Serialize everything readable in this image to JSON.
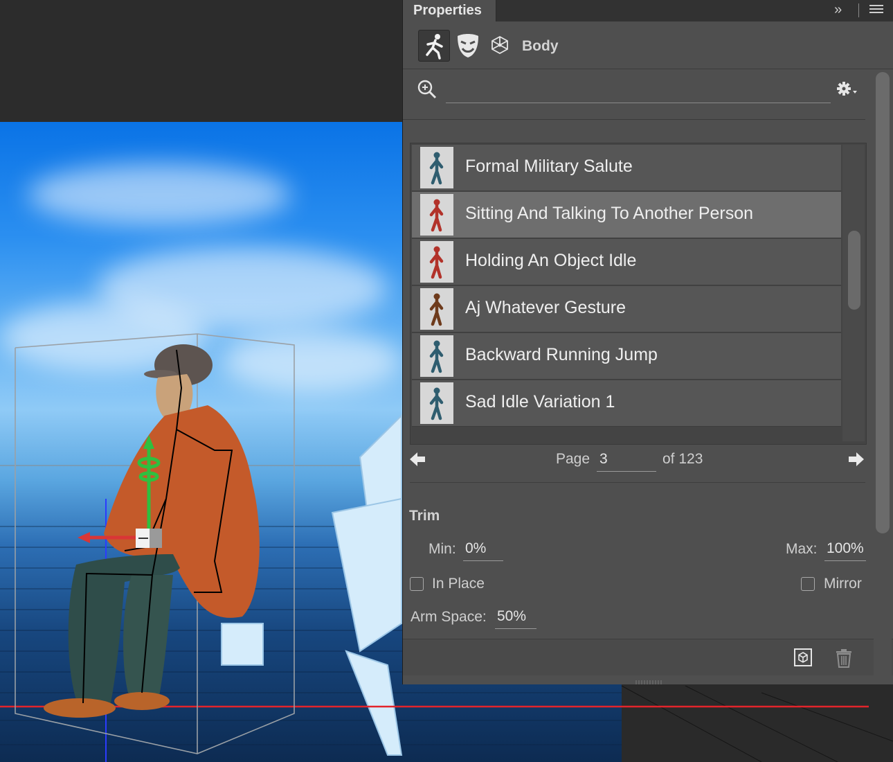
{
  "panel": {
    "title": "Properties",
    "collapse_icon": "double-chevron-right-icon",
    "menu_icon": "hamburger-menu-icon",
    "mode_label": "Body",
    "tools": [
      "body-pose-icon",
      "face-mask-icon",
      "mesh-cube-icon"
    ]
  },
  "search": {
    "value": "",
    "placeholder": "",
    "settings_icon": "gear-dropdown-icon"
  },
  "animations": {
    "items": [
      {
        "label": "Formal Military Salute",
        "thumb_color": "#2f5d6f",
        "selected": false
      },
      {
        "label": "Sitting And Talking To Another Person",
        "thumb_color": "#b2322a",
        "selected": true
      },
      {
        "label": "Holding An Object Idle",
        "thumb_color": "#b2322a",
        "selected": false
      },
      {
        "label": "Aj Whatever Gesture",
        "thumb_color": "#6e3b1c",
        "selected": false
      },
      {
        "label": "Backward Running Jump",
        "thumb_color": "#2f5d6f",
        "selected": false
      },
      {
        "label": "Sad Idle Variation 1",
        "thumb_color": "#2f5d6f",
        "selected": false
      }
    ]
  },
  "pagination": {
    "page_label": "Page",
    "page_value": "3",
    "of_label": "of 123"
  },
  "trim": {
    "title": "Trim",
    "min_label": "Min:",
    "min_value": "0%",
    "max_label": "Max:",
    "max_value": "100%",
    "in_place_label": "In Place",
    "in_place_checked": false,
    "mirror_label": "Mirror",
    "mirror_checked": false,
    "arm_space_label": "Arm Space:",
    "arm_space_value": "50%"
  },
  "footer": {
    "icons": [
      "new-3d-object-icon",
      "trash-icon"
    ]
  }
}
